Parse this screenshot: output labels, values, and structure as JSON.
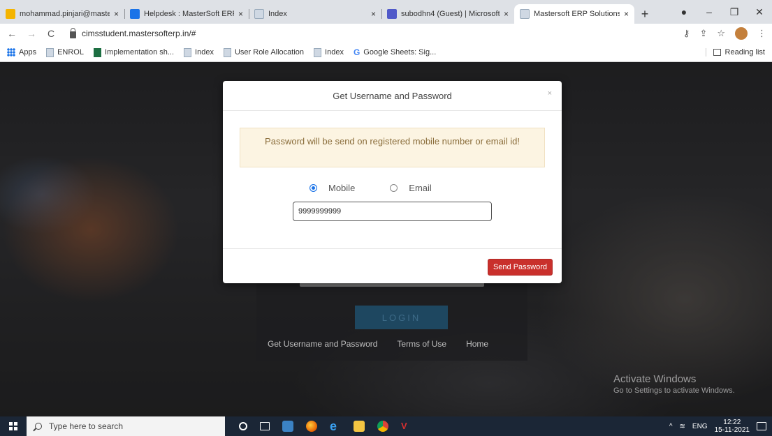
{
  "browser": {
    "tabs": [
      {
        "title": "mohammad.pinjari@masters",
        "color": "#f4b400"
      },
      {
        "title": "Helpdesk : MasterSoft ERP So",
        "color": "#1a73e8"
      },
      {
        "title": "Index",
        "color": "#9ab0c8"
      },
      {
        "title": "subodhn4 (Guest) | Microsoft",
        "color": "#5059c9"
      },
      {
        "title": "Mastersoft ERP Solutions Pvt",
        "color": "#9ab0c8"
      }
    ],
    "close_glyph": "×",
    "new_tab_glyph": "+",
    "address": "cimsstudent.mastersofterp.in/#",
    "bookmarks": [
      {
        "label": "Apps",
        "icon": "apps-icon"
      },
      {
        "label": "ENROL",
        "icon": "page-icon"
      },
      {
        "label": "Implementation sh...",
        "icon": "excel-icon"
      },
      {
        "label": "Index",
        "icon": "page-icon"
      },
      {
        "label": "User Role Allocation",
        "icon": "page-icon"
      },
      {
        "label": "Index",
        "icon": "page-icon"
      },
      {
        "label": "Google Sheets: Sig...",
        "icon": "google-icon"
      }
    ],
    "reading_list": "Reading list"
  },
  "login": {
    "button": "LOGIN",
    "links": [
      "Get Username and Password",
      "Terms of Use",
      "Home"
    ]
  },
  "modal": {
    "title": "Get Username and Password",
    "close": "×",
    "alert": "Password will be send on registered mobile number or email id!",
    "options": [
      {
        "label": "Mobile",
        "checked": true
      },
      {
        "label": "Email",
        "checked": false
      }
    ],
    "mobile_value": "9999999999",
    "send_button": "Send Password"
  },
  "watermark": {
    "line1": "Activate Windows",
    "line2": "Go to Settings to activate Windows."
  },
  "taskbar": {
    "search_placeholder": "Type here to search",
    "lang": "ENG",
    "time": "12:22",
    "date": "15-11-2021"
  }
}
